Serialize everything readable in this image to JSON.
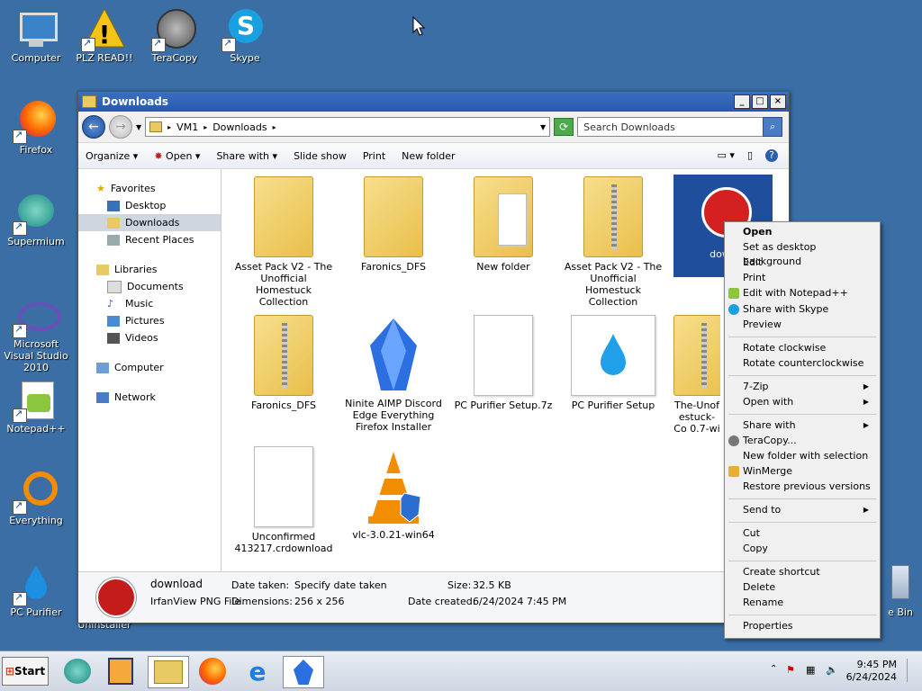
{
  "desktop": {
    "icons": [
      {
        "label": "Computer",
        "icon": "computer-icon"
      },
      {
        "label": "PLZ READ!!",
        "icon": "warning-icon"
      },
      {
        "label": "TeraCopy",
        "icon": "teracopy-icon"
      },
      {
        "label": "Skype",
        "icon": "skype-icon"
      },
      {
        "label": "Firefox",
        "icon": "firefox-icon"
      },
      {
        "label": "Supermium",
        "icon": "supermium-icon"
      },
      {
        "label": "Microsoft Visual Studio 2010",
        "icon": "visual-studio-icon"
      },
      {
        "label": "Notepad++",
        "icon": "notepadpp-icon"
      },
      {
        "label": "Everything",
        "icon": "everything-icon"
      },
      {
        "label": "PC Purifier",
        "icon": "pc-purifier-icon"
      },
      {
        "label": "Uninstaller",
        "icon": "uninstaller-icon"
      },
      {
        "label": "e Bin",
        "icon": "recycle-bin-icon"
      }
    ]
  },
  "window": {
    "title": "Downloads",
    "address": {
      "root": "VM1",
      "folder": "Downloads"
    },
    "search_placeholder": "Search Downloads",
    "toolbar": {
      "organize": "Organize",
      "open": "Open",
      "share_with": "Share with",
      "slide_show": "Slide show",
      "print": "Print",
      "new_folder": "New folder"
    },
    "nav": {
      "favorites": "Favorites",
      "desktop": "Desktop",
      "downloads": "Downloads",
      "recent": "Recent Places",
      "libraries": "Libraries",
      "documents": "Documents",
      "music": "Music",
      "pictures": "Pictures",
      "videos": "Videos",
      "computer": "Computer",
      "network": "Network"
    },
    "files": [
      {
        "label": "Asset Pack V2 - The Unofficial Homestuck Collection",
        "type": "folder"
      },
      {
        "label": "Faronics_DFS",
        "type": "folder"
      },
      {
        "label": "New folder",
        "type": "folder-open"
      },
      {
        "label": "Asset Pack V2 - The Unofficial Homestuck Collection",
        "type": "zip"
      },
      {
        "label": "down",
        "type": "image-selected"
      },
      {
        "label": "Faronics_DFS",
        "type": "zip"
      },
      {
        "label": "Ninite AIMP Discord Edge Everything Firefox Installer",
        "type": "ninite"
      },
      {
        "label": "PC Purifier Setup.7z",
        "type": "blank"
      },
      {
        "label": "PC Purifier Setup",
        "type": "pcpurifier"
      },
      {
        "label": "The-Unof estuck-Co 0.7-wi",
        "type": "zip"
      },
      {
        "label": "Unconfirmed 413217.crdownload",
        "type": "blank"
      },
      {
        "label": "vlc-3.0.21-win64",
        "type": "vlc"
      }
    ],
    "details": {
      "name": "download",
      "type": "IrfanView PNG File",
      "taken_label": "Date taken:",
      "taken_value": "Specify date taken",
      "size_label": "Size:",
      "size_value": "32.5 KB",
      "dim_label": "Dimensions:",
      "dim_value": "256 x 256",
      "created_label": "Date created:",
      "created_value": "6/24/2024 7:45 PM"
    }
  },
  "context_menu": {
    "open": "Open",
    "set_bg": "Set as desktop background",
    "edit": "Edit",
    "print": "Print",
    "notepad": "Edit with Notepad++",
    "skype": "Share with Skype",
    "preview": "Preview",
    "rot_cw": "Rotate clockwise",
    "rot_ccw": "Rotate counterclockwise",
    "sevenzip": "7-Zip",
    "open_with": "Open with",
    "share_with": "Share with",
    "teracopy": "TeraCopy...",
    "new_folder_sel": "New folder with selection",
    "winmerge": "WinMerge",
    "restore": "Restore previous versions",
    "send_to": "Send to",
    "cut": "Cut",
    "copy": "Copy",
    "shortcut": "Create shortcut",
    "delete": "Delete",
    "rename": "Rename",
    "properties": "Properties"
  },
  "taskbar": {
    "start": "Start",
    "time": "9:45 PM",
    "date": "6/24/2024"
  }
}
